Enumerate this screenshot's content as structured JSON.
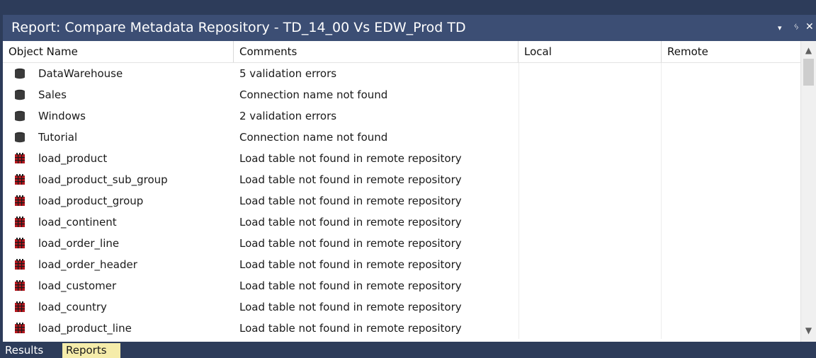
{
  "window": {
    "title": "Report: Compare Metadata Repository - TD_14_00 Vs EDW_Prod TD",
    "menu_glyph": "▾",
    "pin_glyph": "ᛃ",
    "close_glyph": "✕"
  },
  "table": {
    "columns": [
      "Object Name",
      "Comments",
      "Local",
      "Remote"
    ],
    "rows": [
      {
        "icon": "database-icon",
        "name": "DataWarehouse",
        "comment": "5 validation errors",
        "local": "",
        "remote": ""
      },
      {
        "icon": "database-icon",
        "name": "Sales",
        "comment": "Connection name not found",
        "local": "",
        "remote": ""
      },
      {
        "icon": "database-icon",
        "name": "Windows",
        "comment": "2 validation errors",
        "local": "",
        "remote": ""
      },
      {
        "icon": "database-icon",
        "name": "Tutorial",
        "comment": "Connection name not found",
        "local": "",
        "remote": ""
      },
      {
        "icon": "load-table-icon",
        "name": "load_product",
        "comment": "Load table not found in remote repository",
        "local": "",
        "remote": ""
      },
      {
        "icon": "load-table-icon",
        "name": "load_product_sub_group",
        "comment": "Load table not found in remote repository",
        "local": "",
        "remote": ""
      },
      {
        "icon": "load-table-icon",
        "name": "load_product_group",
        "comment": "Load table not found in remote repository",
        "local": "",
        "remote": ""
      },
      {
        "icon": "load-table-icon",
        "name": "load_continent",
        "comment": "Load table not found in remote repository",
        "local": "",
        "remote": ""
      },
      {
        "icon": "load-table-icon",
        "name": "load_order_line",
        "comment": "Load table not found in remote repository",
        "local": "",
        "remote": ""
      },
      {
        "icon": "load-table-icon",
        "name": "load_order_header",
        "comment": "Load table not found in remote repository",
        "local": "",
        "remote": ""
      },
      {
        "icon": "load-table-icon",
        "name": "load_customer",
        "comment": "Load table not found in remote repository",
        "local": "",
        "remote": ""
      },
      {
        "icon": "load-table-icon",
        "name": "load_country",
        "comment": "Load table not found in remote repository",
        "local": "",
        "remote": ""
      },
      {
        "icon": "load-table-icon",
        "name": "load_product_line",
        "comment": "Load table not found in remote repository",
        "local": "",
        "remote": ""
      }
    ]
  },
  "tabs": [
    {
      "label": "Results",
      "active": false
    },
    {
      "label": "Reports",
      "active": true
    }
  ],
  "colors": {
    "titlebar": "#3c4e74",
    "frame": "#2d3c5a",
    "active_tab": "#f5ecaa",
    "load_icon": "#b5171e",
    "db_icon": "#3a3a3a"
  }
}
